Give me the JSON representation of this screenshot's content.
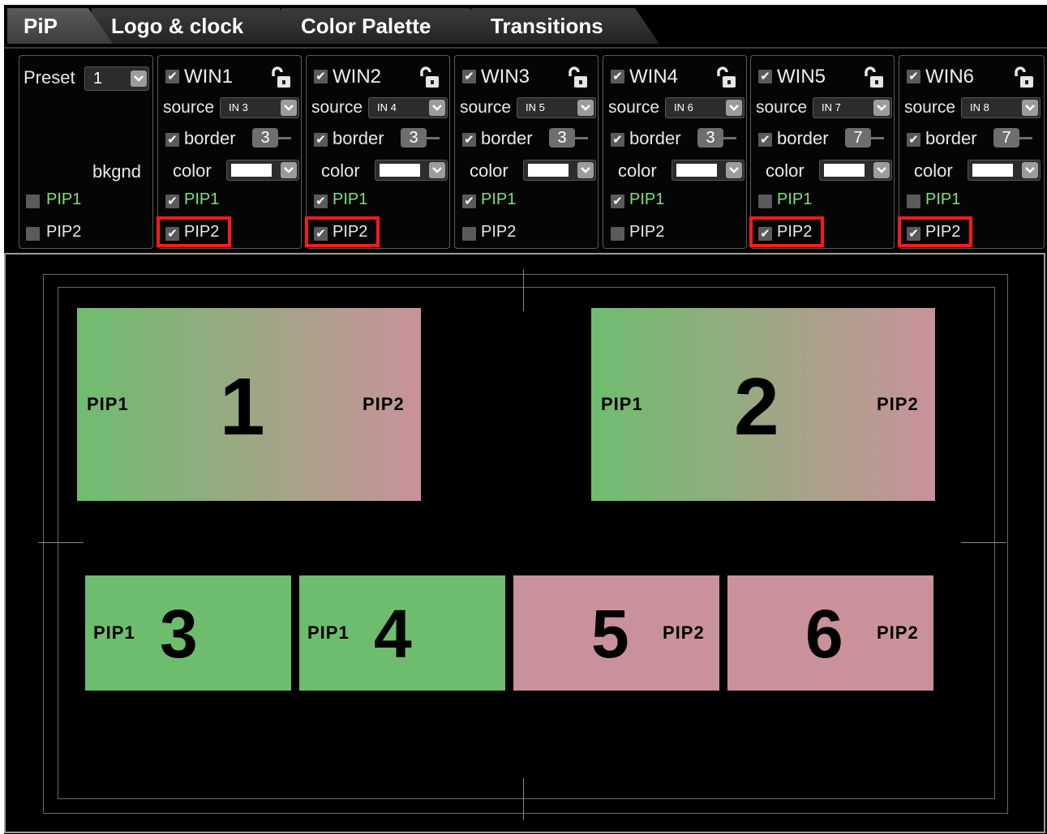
{
  "tabs": [
    {
      "label": "PiP",
      "active": true
    },
    {
      "label": "Logo & clock"
    },
    {
      "label": "Color Palette"
    },
    {
      "label": "Transitions"
    }
  ],
  "preset_panel": {
    "preset_label": "Preset",
    "preset_value": "1",
    "bkgnd_label": "bkgnd",
    "pip1": {
      "label": "PIP1",
      "checked": false
    },
    "pip2": {
      "label": "PIP2",
      "checked": false
    }
  },
  "labels": {
    "source": "source",
    "border": "border",
    "color": "color"
  },
  "windows": [
    {
      "name": "WIN1",
      "enabled": true,
      "source": "IN 3",
      "border": true,
      "border_width": "3",
      "color": "#ffffff",
      "pip1_label": "PIP1",
      "pip1": true,
      "pip2_label": "PIP2",
      "pip2": true,
      "pip2_highlighted": true
    },
    {
      "name": "WIN2",
      "enabled": true,
      "source": "IN 4",
      "border": true,
      "border_width": "3",
      "color": "#ffffff",
      "pip1_label": "PIP1",
      "pip1": true,
      "pip2_label": "PIP2",
      "pip2": true,
      "pip2_highlighted": true
    },
    {
      "name": "WIN3",
      "enabled": true,
      "source": "IN 5",
      "border": true,
      "border_width": "3",
      "color": "#ffffff",
      "pip1_label": "PIP1",
      "pip1": true,
      "pip2_label": "PIP2",
      "pip2": false,
      "pip2_highlighted": false
    },
    {
      "name": "WIN4",
      "enabled": true,
      "source": "IN 6",
      "border": true,
      "border_width": "3",
      "color": "#ffffff",
      "pip1_label": "PIP1",
      "pip1": true,
      "pip2_label": "PIP2",
      "pip2": false,
      "pip2_highlighted": false
    },
    {
      "name": "WIN5",
      "enabled": true,
      "source": "IN 7",
      "border": true,
      "border_width": "7",
      "color": "#ffffff",
      "pip1_label": "PIP1",
      "pip1": false,
      "pip2_label": "PIP2",
      "pip2": true,
      "pip2_highlighted": true
    },
    {
      "name": "WIN6",
      "enabled": true,
      "source": "IN 8",
      "border": true,
      "border_width": "7",
      "color": "#ffffff",
      "pip1_label": "PIP1",
      "pip1": false,
      "pip2_label": "PIP2",
      "pip2": true,
      "pip2_highlighted": true
    }
  ],
  "preview": {
    "windows": [
      {
        "number": "1",
        "pip1_label": "PIP1",
        "pip2_label": "PIP2"
      },
      {
        "number": "2",
        "pip1_label": "PIP1",
        "pip2_label": "PIP2"
      },
      {
        "number": "3",
        "pip1_label": "PIP1"
      },
      {
        "number": "4",
        "pip1_label": "PIP1"
      },
      {
        "number": "5",
        "pip2_label": "PIP2"
      },
      {
        "number": "6",
        "pip2_label": "PIP2"
      }
    ],
    "colors": {
      "pip1": "#6ebd6e",
      "pip2": "#c9929a",
      "highlight": "#ff1a1a"
    }
  }
}
